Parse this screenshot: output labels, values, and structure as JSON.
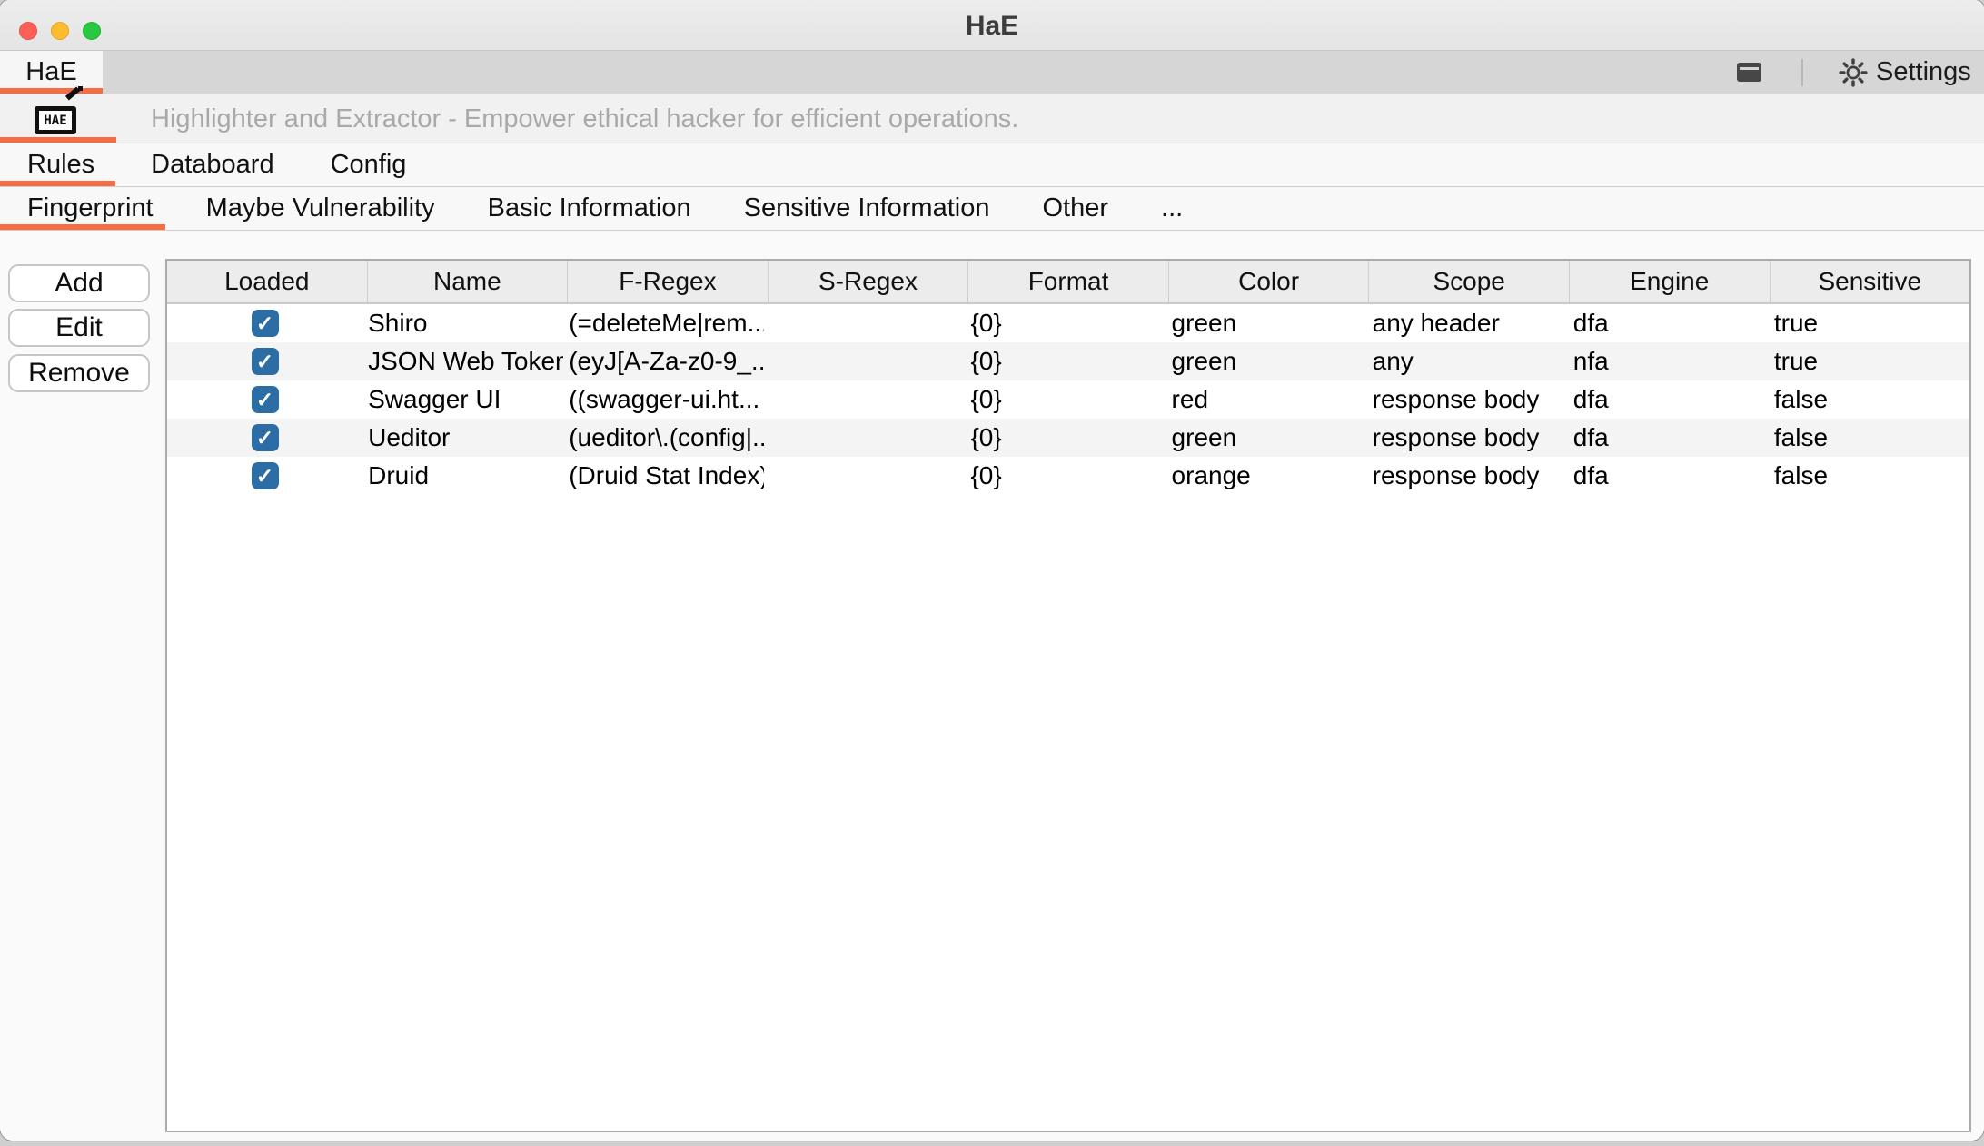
{
  "window": {
    "title": "HaE"
  },
  "tab_bar": {
    "tab_label": "HaE",
    "settings_label": "Settings"
  },
  "banner": {
    "logo_text": "HAE",
    "subtitle": "Highlighter and Extractor - Empower ethical hacker for efficient operations."
  },
  "main_tabs": {
    "items": [
      "Rules",
      "Databoard",
      "Config"
    ],
    "selected": "Rules"
  },
  "sub_tabs": {
    "items": [
      "Fingerprint",
      "Maybe Vulnerability",
      "Basic Information",
      "Sensitive Information",
      "Other",
      "..."
    ],
    "selected": "Fingerprint"
  },
  "actions": {
    "add": "Add",
    "edit": "Edit",
    "remove": "Remove"
  },
  "table": {
    "columns": [
      "Loaded",
      "Name",
      "F-Regex",
      "S-Regex",
      "Format",
      "Color",
      "Scope",
      "Engine",
      "Sensitive"
    ],
    "rows": [
      {
        "loaded": true,
        "name": "Shiro",
        "f_regex": "(=deleteMe|rem...",
        "s_regex": "",
        "format": "{0}",
        "color": "green",
        "scope": "any header",
        "engine": "dfa",
        "sensitive": "true"
      },
      {
        "loaded": true,
        "name": "JSON Web Token",
        "f_regex": "(eyJ[A-Za-z0-9_...",
        "s_regex": "",
        "format": "{0}",
        "color": "green",
        "scope": "any",
        "engine": "nfa",
        "sensitive": "true"
      },
      {
        "loaded": true,
        "name": "Swagger UI",
        "f_regex": "((swagger-ui.ht...",
        "s_regex": "",
        "format": "{0}",
        "color": "red",
        "scope": "response body",
        "engine": "dfa",
        "sensitive": "false"
      },
      {
        "loaded": true,
        "name": "Ueditor",
        "f_regex": "(ueditor\\.(config|...",
        "s_regex": "",
        "format": "{0}",
        "color": "green",
        "scope": "response body",
        "engine": "dfa",
        "sensitive": "false"
      },
      {
        "loaded": true,
        "name": "Druid",
        "f_regex": "(Druid Stat Index)",
        "s_regex": "",
        "format": "{0}",
        "color": "orange",
        "scope": "response body",
        "engine": "dfa",
        "sensitive": "false"
      }
    ]
  },
  "icons": {
    "check": "✓"
  },
  "colors": {
    "accent": "#f76c43",
    "checkbox_blue": "#2d6da5",
    "traffic_red": "#ff5f57",
    "traffic_yellow": "#febc2e",
    "traffic_green": "#28c840"
  }
}
